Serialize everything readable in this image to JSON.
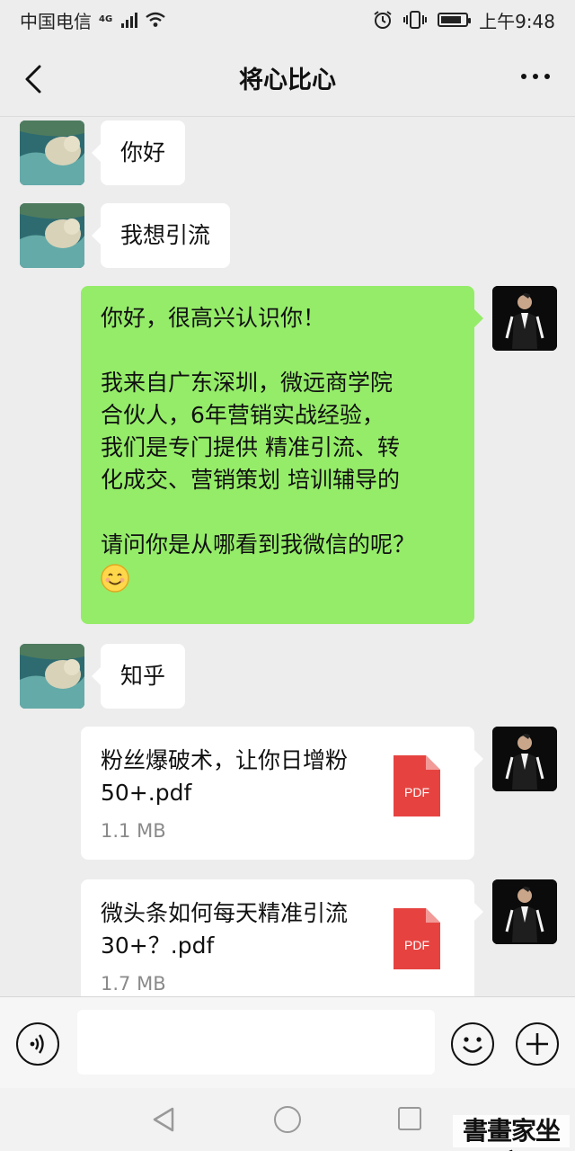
{
  "status_bar": {
    "carrier": "中国电信",
    "network": "4G",
    "time": "上午9:48"
  },
  "nav": {
    "title": "将心比心"
  },
  "messages": [
    {
      "side": "left",
      "avatar": "polar-bear-avatar",
      "text": "你好"
    },
    {
      "side": "left",
      "avatar": "polar-bear-avatar",
      "text": "我想引流"
    },
    {
      "side": "right",
      "avatar": "man-in-vest-avatar",
      "lines": [
        "你好，很高兴认识你！",
        "",
        "我来自广东深圳，微远商学院",
        "合伙人，6年营销实战经验，",
        "我们是专门提供 精准引流、转",
        "化成交、营销策划 培训辅导的",
        "",
        "请问你是从哪看到我微信的呢？",
        "😊"
      ]
    },
    {
      "side": "left",
      "avatar": "polar-bear-avatar",
      "text": "知乎"
    },
    {
      "side": "right",
      "avatar": "man-in-vest-avatar",
      "type": "file",
      "file_name": "粉丝爆破术，让你日增粉 50+.pdf",
      "file_size": "1.1 MB",
      "file_icon_label": "PDF"
    },
    {
      "side": "right",
      "avatar": "man-in-vest-avatar",
      "type": "file",
      "file_name": "微头条如何每天精准引流 30+？.pdf",
      "file_size": "1.7 MB",
      "file_icon_label": "PDF"
    }
  ],
  "input_bar": {
    "placeholder": ""
  },
  "watermark": "書畫家坐家",
  "colors": {
    "background": "#ededed",
    "sent_bubble": "#95ec69",
    "received_bubble": "#ffffff",
    "pdf_icon": "#e64340"
  }
}
